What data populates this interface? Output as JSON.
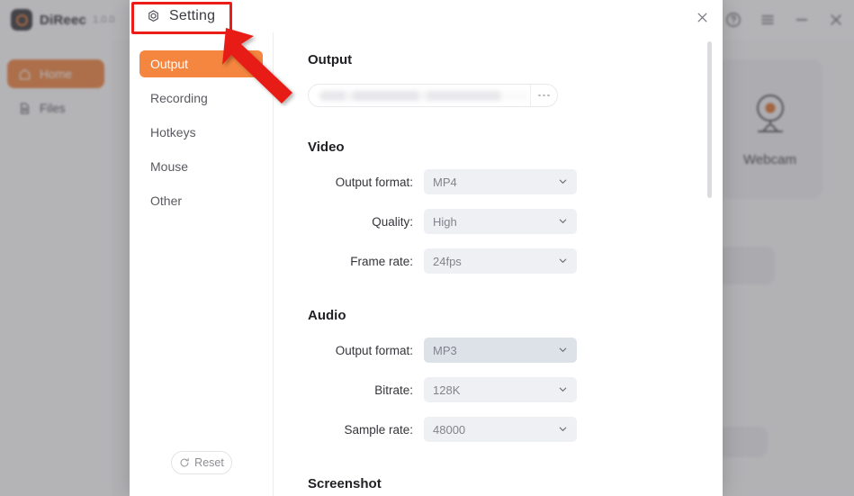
{
  "app": {
    "brand": "DiReec",
    "version": "1.0.0",
    "sidebar": [
      {
        "label": "Home",
        "icon": "home-icon",
        "active": true
      },
      {
        "label": "Files",
        "icon": "file-icon",
        "active": false
      }
    ],
    "cards": [
      {
        "label": "Webcam",
        "icon": "webcam-icon"
      }
    ],
    "window_controls": [
      {
        "name": "help-icon",
        "glyph": "?"
      },
      {
        "name": "menu-icon",
        "glyph": "☰"
      },
      {
        "name": "minimize-icon",
        "glyph": "−"
      },
      {
        "name": "close-icon",
        "glyph": "✕"
      }
    ],
    "accent_color": "#f08037"
  },
  "dialog": {
    "title": "Setting",
    "title_icon": "gear-icon",
    "close_icon": "close-icon",
    "nav": [
      {
        "label": "Output",
        "active": true
      },
      {
        "label": "Recording",
        "active": false
      },
      {
        "label": "Hotkeys",
        "active": false
      },
      {
        "label": "Mouse",
        "active": false
      },
      {
        "label": "Other",
        "active": false
      }
    ],
    "reset": {
      "label": "Reset",
      "icon": "refresh-icon"
    },
    "sections": {
      "output": {
        "title": "Output",
        "path_value": "",
        "path_placeholder": "",
        "browse_icon": "ellipsis-icon"
      },
      "video": {
        "title": "Video",
        "fields": [
          {
            "label": "Output format:",
            "value": "MP4",
            "hovered": false
          },
          {
            "label": "Quality:",
            "value": "High",
            "hovered": false
          },
          {
            "label": "Frame rate:",
            "value": "24fps",
            "hovered": false
          }
        ]
      },
      "audio": {
        "title": "Audio",
        "fields": [
          {
            "label": "Output format:",
            "value": "MP3",
            "hovered": true
          },
          {
            "label": "Bitrate:",
            "value": "128K",
            "hovered": false
          },
          {
            "label": "Sample rate:",
            "value": "48000",
            "hovered": false
          }
        ]
      },
      "screenshot": {
        "title": "Screenshot"
      }
    },
    "accent_color": "#f5863f",
    "field_bg": "#eef0f4",
    "field_bg_hover": "#dde1e8"
  },
  "annotation": {
    "highlight_color": "#ec1c18",
    "arrow_color": "#e81d16",
    "target": "Setting"
  }
}
